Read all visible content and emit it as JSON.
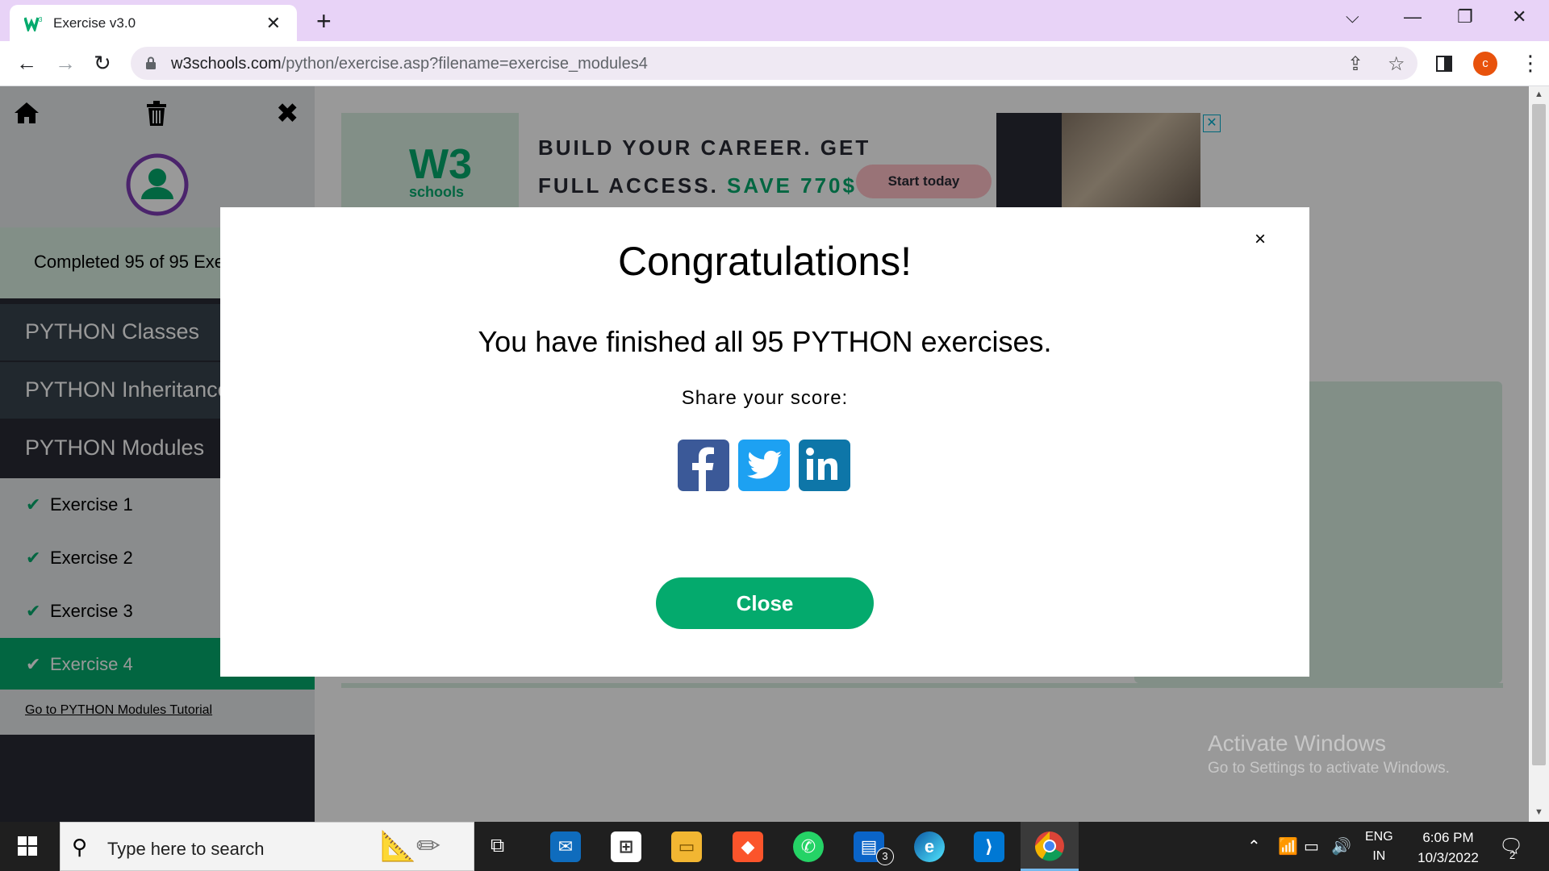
{
  "browser": {
    "tab_title": "Exercise v3.0",
    "url_domain": "w3schools.com",
    "url_path": "/python/exercise.asp?filename=exercise_modules4",
    "profile_initial": "c"
  },
  "sidebar": {
    "score_text": "Completed 95 of 95 Exe",
    "sections": [
      {
        "label": "PYTHON Classes"
      },
      {
        "label": "PYTHON Inheritance"
      },
      {
        "label": "PYTHON Modules"
      }
    ],
    "exercises": [
      {
        "label": "Exercise 1",
        "completed": true
      },
      {
        "label": "Exercise 2",
        "completed": true
      },
      {
        "label": "Exercise 3",
        "completed": true
      },
      {
        "label": "Exercise 4",
        "completed": true,
        "active": true
      }
    ],
    "tutorial_link": "Go to PYTHON Modules Tutorial"
  },
  "ad": {
    "logo_text": "W3",
    "logo_sub": "schools",
    "line1": "BUILD YOUR CAREER. GET",
    "line2_prefix": "FULL ACCESS.",
    "line2_highlight": "SAVE 770$",
    "cta": "Start today"
  },
  "modal": {
    "title": "Congratulations!",
    "message": "You have finished all 95 PYTHON exercises.",
    "share_label": "Share your score:",
    "social": [
      "facebook",
      "twitter",
      "linkedin"
    ],
    "close_label": "Close"
  },
  "watermark": {
    "line1": "Activate Windows",
    "line2": "Go to Settings to activate Windows."
  },
  "taskbar": {
    "search_placeholder": "Type here to search",
    "language": "ENG",
    "region": "IN",
    "time": "6:06 PM",
    "date": "10/3/2022",
    "notification_count": "2",
    "app_badge": "3"
  },
  "colors": {
    "accent_green": "#04aa6d",
    "sidebar_dark": "#282a35",
    "tab_bar": "#e8d3f7"
  }
}
